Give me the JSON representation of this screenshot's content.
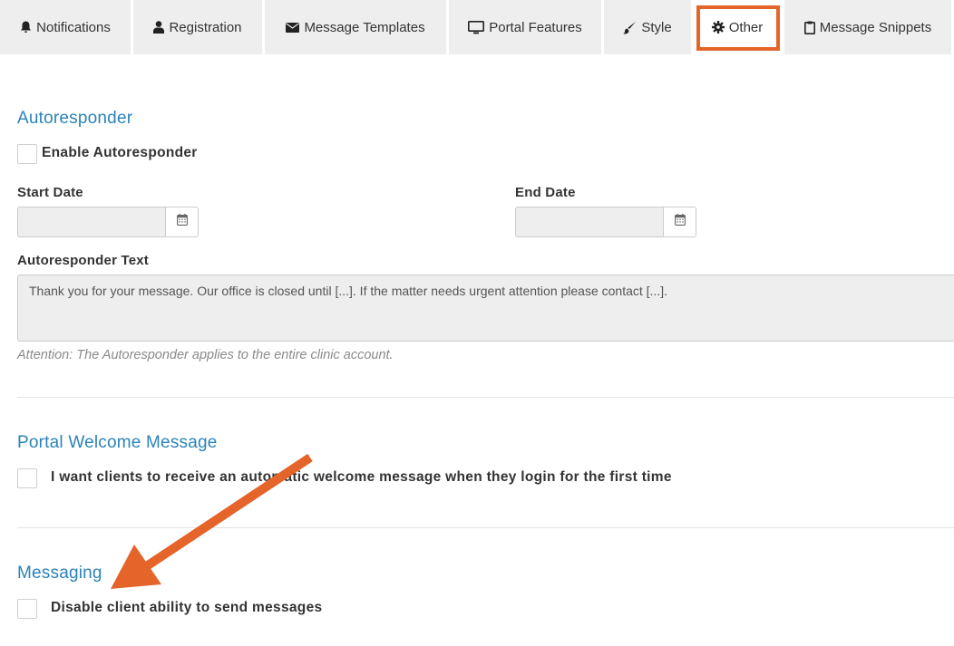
{
  "tabs": [
    {
      "label": "Notifications",
      "icon": "bell-icon"
    },
    {
      "label": "Registration",
      "icon": "user-icon"
    },
    {
      "label": "Message Templates",
      "icon": "envelope-icon"
    },
    {
      "label": "Portal Features",
      "icon": "monitor-icon"
    },
    {
      "label": "Style",
      "icon": "brush-icon"
    },
    {
      "label": "Other",
      "icon": "gear-icon",
      "active": true
    },
    {
      "label": "Message Snippets",
      "icon": "clipboard-icon"
    }
  ],
  "autoresponder": {
    "title": "Autoresponder",
    "enable_label": "Enable Autoresponder",
    "enabled": false,
    "start_date_label": "Start Date",
    "start_date_value": "",
    "end_date_label": "End Date",
    "end_date_value": "",
    "text_label": "Autoresponder Text",
    "text_value": "Thank you for your message. Our office is closed until [...]. If the matter needs urgent attention please contact [...].",
    "help": "Attention: The Autoresponder applies to the entire clinic account."
  },
  "welcome": {
    "title": "Portal Welcome Message",
    "checkbox_label": "I want clients to receive an automatic welcome message when they login for the first time",
    "checked": false
  },
  "messaging": {
    "title": "Messaging",
    "checkbox_label": "Disable client ability to send messages",
    "checked": false
  },
  "colors": {
    "accent": "#2b83b9",
    "highlight": "#e4642a",
    "tab_bg": "#eeeeee"
  }
}
